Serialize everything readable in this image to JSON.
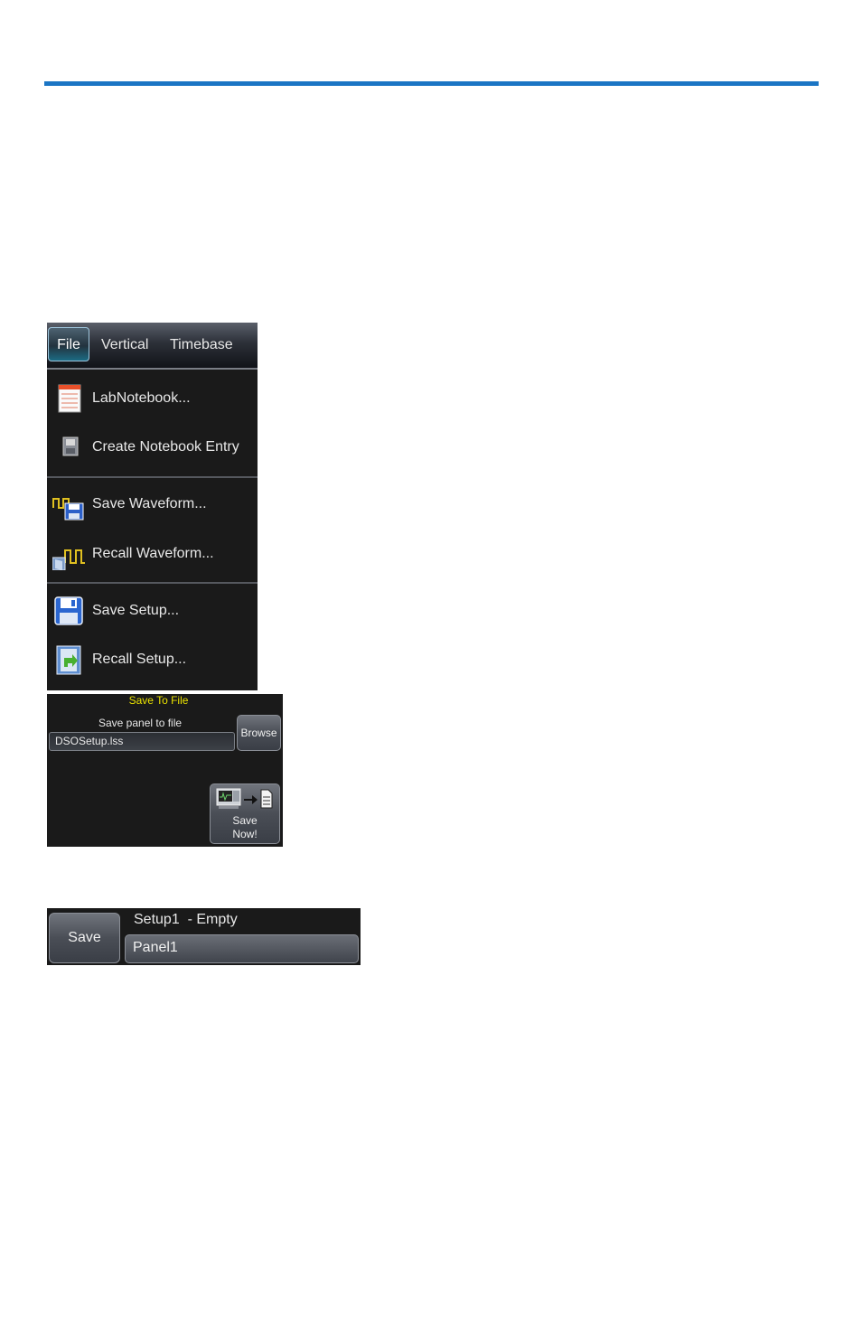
{
  "colors": {
    "accent_rule": "#1b75c4",
    "panel_bg": "#1a1a1a",
    "title_yellow": "#e8e000"
  },
  "menu": {
    "tabs": [
      "File",
      "Vertical",
      "Timebase"
    ],
    "active_tab": "File",
    "items": [
      {
        "label": "LabNotebook...",
        "icon": "notebook-icon"
      },
      {
        "label": "Create Notebook Entry",
        "icon": "create-entry-icon"
      },
      {
        "label": "Save Waveform...",
        "icon": "save-waveform-icon"
      },
      {
        "label": "Recall Waveform...",
        "icon": "recall-waveform-icon"
      },
      {
        "label": "Save Setup...",
        "icon": "save-setup-icon"
      },
      {
        "label": "Recall Setup...",
        "icon": "recall-setup-icon"
      }
    ]
  },
  "save_to_file": {
    "title": "Save To File",
    "field_label": "Save panel to file",
    "filename": "DSOSetup.lss",
    "browse_label": "Browse",
    "save_now_line1": "Save",
    "save_now_line2": "Now!"
  },
  "setup_strip": {
    "save_label": "Save",
    "slot_label": "Setup1  - Empty",
    "name_value": "Panel1"
  }
}
